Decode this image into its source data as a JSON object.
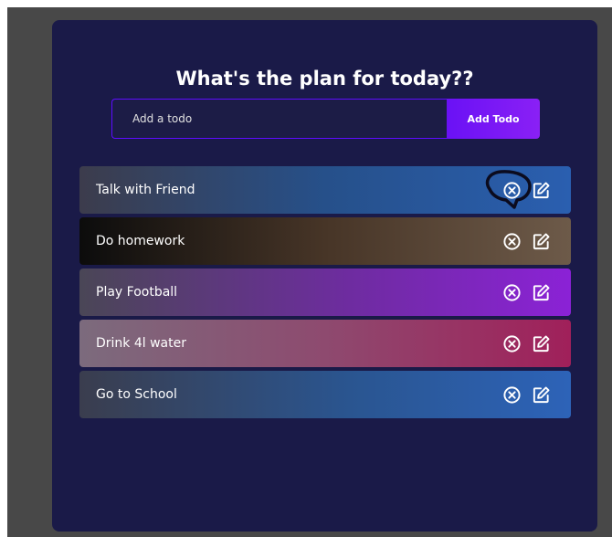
{
  "header": {
    "title": "What's the plan for today??"
  },
  "form": {
    "placeholder": "Add a todo",
    "button_label": "Add Todo"
  },
  "todos": [
    {
      "text": "Talk with Friend"
    },
    {
      "text": "Do homework"
    },
    {
      "text": "Play Football"
    },
    {
      "text": "Drink 4l water"
    },
    {
      "text": "Go to School"
    }
  ],
  "icons": {
    "delete": "close-circle-icon",
    "edit": "edit-icon"
  },
  "colors": {
    "page_background": "#484848",
    "app_background": "#1a1a48",
    "accent": "#5d0cff",
    "button": "#8a20f5"
  }
}
